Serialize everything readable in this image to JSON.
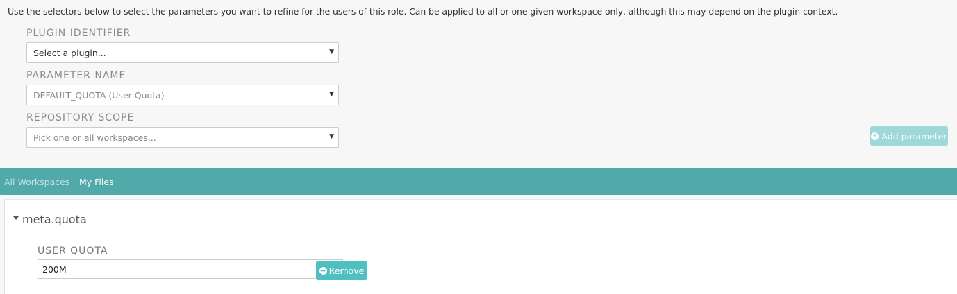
{
  "intro": "Use the selectors below to select the parameters you want to refine for the users of this role. Can be applied to all or one given workspace only, although this may depend on the plugin context.",
  "form": {
    "plugin_label": "PLUGIN IDENTIFIER",
    "plugin_value": "Select a plugin...",
    "param_label": "PARAMETER NAME",
    "param_value": "DEFAULT_QUOTA (User Quota)",
    "scope_label": "REPOSITORY SCOPE",
    "scope_value": "Pick one or all workspaces...",
    "add_button": "Add parameter"
  },
  "tabs": [
    {
      "label": "All Workspaces",
      "active": false
    },
    {
      "label": "My Files",
      "active": true
    }
  ],
  "group": {
    "title": "meta.quota",
    "field_label": "USER QUOTA",
    "field_value": "200M",
    "remove_button": "Remove"
  },
  "colors": {
    "tabbar": "#52a9a9",
    "button_primary": "#4fbfbf",
    "button_disabled": "#9fd8d8"
  },
  "icons": {
    "add": "plus-circle-icon",
    "remove": "minus-circle-icon",
    "dropdown": "caret-down-icon",
    "expand": "caret-down-icon"
  }
}
